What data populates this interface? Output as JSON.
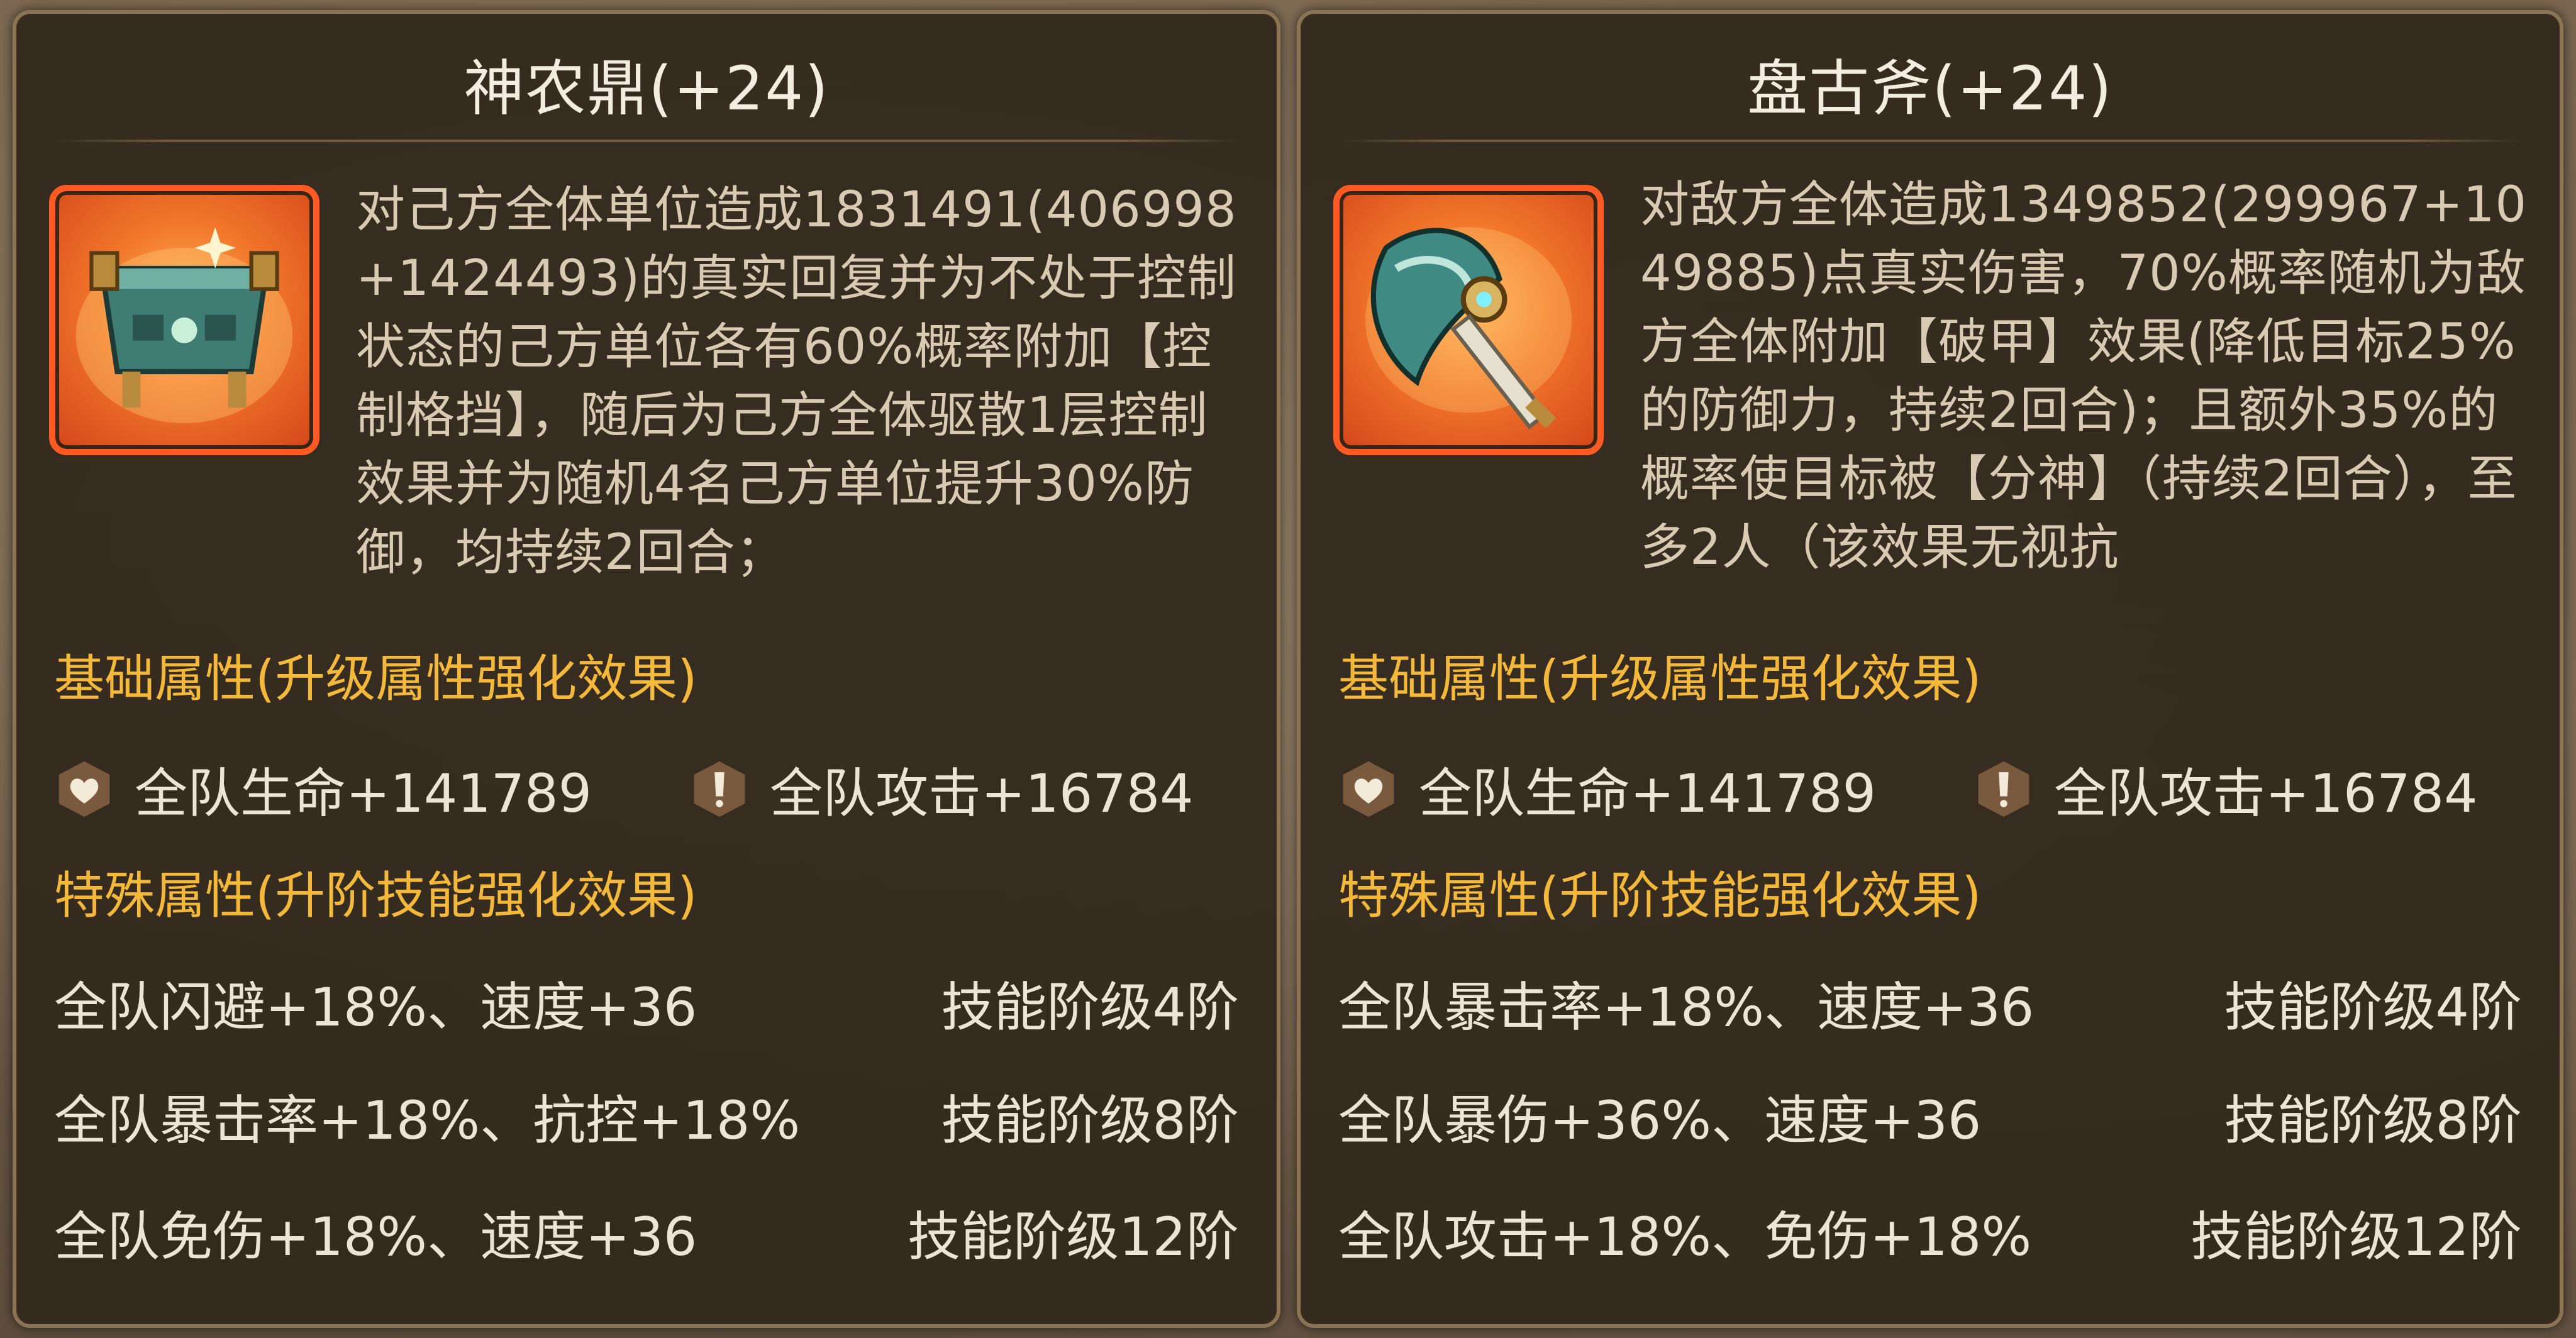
{
  "colors": {
    "panel_bg": "#31271c",
    "panel_border": "#8a7454",
    "title": "#f3ece0",
    "description": "#d9cbb3",
    "section_heading": "#f4b93a",
    "stat_text": "#ece4d6",
    "icon_frame": "#ff5a24"
  },
  "artifacts": [
    {
      "title": "神农鼎(+24)",
      "icon": "bronze-cauldron-icon",
      "description": "对己方全体单位造成1831491(406998+1424493)的真实回复并为不处于控制状态的己方单位各有60%概率附加【控制格挡】，随后为己方全体驱散1层控制效果并为随机4名己方单位提升30%防御，均持续2回合；",
      "basic_heading": "基础属性(升级属性强化效果)",
      "basic_stats": {
        "hp_icon": "heart-icon",
        "hp": "全队生命+141789",
        "atk_icon": "attack-icon",
        "atk": "全队攻击+16784"
      },
      "special_heading": "特殊属性(升阶技能强化效果)",
      "special_stats": [
        {
          "effect": "全队闪避+18%、速度+36",
          "level": "技能阶级4阶"
        },
        {
          "effect": "全队暴击率+18%、抗控+18%",
          "level": "技能阶级8阶"
        },
        {
          "effect": "全队免伤+18%、速度+36",
          "level": "技能阶级12阶"
        }
      ]
    },
    {
      "title": "盘古斧(+24)",
      "icon": "battle-axe-icon",
      "description": "对敌方全体造成1349852(299967+1049885)点真实伤害，70%概率随机为敌方全体附加【破甲】效果(降低目标25%的防御力，持续2回合)；且额外35%的概率使目标被【分神】（持续2回合），至多2人（该效果无视抗",
      "basic_heading": "基础属性(升级属性强化效果)",
      "basic_stats": {
        "hp_icon": "heart-icon",
        "hp": "全队生命+141789",
        "atk_icon": "attack-icon",
        "atk": "全队攻击+16784"
      },
      "special_heading": "特殊属性(升阶技能强化效果)",
      "special_stats": [
        {
          "effect": "全队暴击率+18%、速度+36",
          "level": "技能阶级4阶"
        },
        {
          "effect": "全队暴伤+36%、速度+36",
          "level": "技能阶级8阶"
        },
        {
          "effect": "全队攻击+18%、免伤+18%",
          "level": "技能阶级12阶"
        }
      ]
    }
  ]
}
